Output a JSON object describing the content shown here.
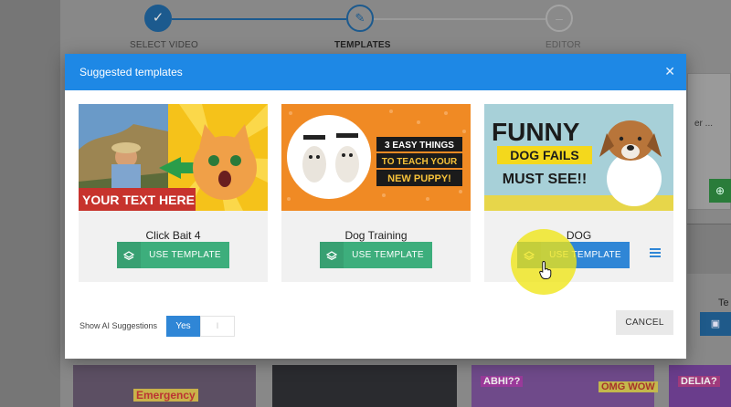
{
  "stepper": {
    "steps": [
      {
        "label": "SELECT VIDEO",
        "icon": "check-icon"
      },
      {
        "label": "TEMPLATES",
        "icon": "pencil-icon"
      },
      {
        "label": "EDITOR",
        "icon": "dash-icon"
      }
    ]
  },
  "background": {
    "right_card_text": "er ...",
    "right_label": "Te",
    "thumbs": [
      "Emergency",
      "ABHI??",
      "OMG WOW",
      "DELIA?"
    ]
  },
  "modal": {
    "title": "Suggested templates",
    "close_icon": "close-icon",
    "templates": [
      {
        "name": "Click Bait 4",
        "button": "USE TEMPLATE",
        "image_text": "YOUR TEXT HERE"
      },
      {
        "name": "Dog Training",
        "button": "USE TEMPLATE",
        "image_text": [
          "3 EASY THINGS",
          "TO TEACH YOUR",
          "NEW PUPPY!"
        ]
      },
      {
        "name": "DOG",
        "button": "USE TEMPLATE",
        "image_text": [
          "FUNNY",
          "DOG FAILS",
          "MUST SEE!!"
        ]
      }
    ],
    "ai_suggestions": {
      "label": "Show AI Suggestions",
      "yes": "Yes",
      "no": "I"
    },
    "cancel": "CANCEL"
  },
  "colors": {
    "header_blue": "#1e88e5",
    "green_button": "#3dae7c",
    "blue_button": "#2f86d6",
    "highlight_yellow": "#f0e614"
  }
}
